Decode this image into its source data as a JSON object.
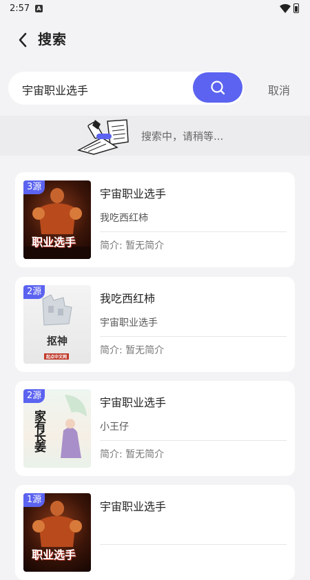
{
  "status": {
    "time": "2:57"
  },
  "header": {
    "title": "搜索"
  },
  "search": {
    "query": "宇宙职业选手",
    "cancel_label": "取消"
  },
  "loading": {
    "text": "搜索中，请稍等..."
  },
  "results": [
    {
      "badge": "3源",
      "title": "宇宙职业选手",
      "author": "我吃西红柿",
      "intro": "简介: 暂无简介",
      "cover_text": "职业选手"
    },
    {
      "badge": "2源",
      "title": "我吃西红柿",
      "author": "宇宙职业选手",
      "intro": "简介: 暂无简介",
      "cover_text": "抠神",
      "cover_footer": "起点中文网"
    },
    {
      "badge": "2源",
      "title": "宇宙职业选手",
      "author": "小王仔",
      "intro": "简介: 暂无简介",
      "cover_text": "家有长姜"
    },
    {
      "badge": "1源",
      "title": "宇宙职业选手",
      "author": "",
      "intro": "",
      "cover_text": "职业选手"
    }
  ],
  "colors": {
    "accent": "#5b63f0",
    "background": "#f3f3f5"
  }
}
